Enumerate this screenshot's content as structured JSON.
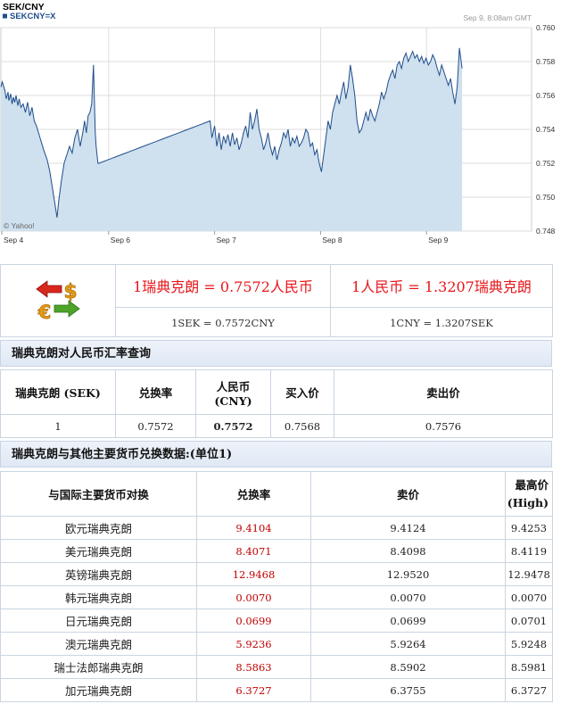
{
  "chart_data": {
    "type": "area",
    "title": "SEK/CNY",
    "legend": "SEKCNY=X",
    "timestamp": "Sep 9, 8:08am GMT",
    "watermark": "© Yahoo!",
    "x_labels": [
      "Sep 4",
      "Sep 6",
      "Sep 7",
      "Sep 8",
      "Sep 9"
    ],
    "y_ticks": [
      "0.760",
      "0.758",
      "0.756",
      "0.754",
      "0.752",
      "0.750",
      "0.748"
    ],
    "ylim": [
      0.748,
      0.76
    ],
    "grid": true,
    "colors": {
      "line": "#1f4e8c",
      "fill": "#cfe0ee",
      "grid": "#dddddd"
    },
    "x": [
      0,
      1.5,
      4.5,
      6,
      8,
      9,
      11,
      12.5,
      14,
      15.5,
      17,
      19,
      20.5,
      22.5,
      25,
      27.5,
      30,
      32.5,
      35,
      37.5,
      40,
      44,
      48,
      52,
      55,
      58,
      61,
      63,
      65,
      68,
      71,
      74,
      77,
      80,
      83,
      86,
      89,
      92,
      94,
      96,
      98,
      100,
      102,
      104,
      105,
      106,
      107,
      108,
      109,
      110,
      115,
      120,
      125,
      130,
      135,
      140,
      145,
      150,
      155,
      160,
      165,
      170,
      175,
      180,
      185,
      190,
      195,
      200,
      205,
      210,
      215,
      220,
      225,
      230,
      235,
      237,
      240,
      242.5,
      245,
      247.5,
      250,
      252.5,
      255,
      257.5,
      260,
      262.5,
      265,
      267.5,
      270,
      272.5,
      275,
      277.5,
      280,
      282.5,
      285,
      287.5,
      290,
      292.5,
      295,
      297.5,
      300,
      302.5,
      305,
      307.5,
      310,
      312.5,
      315,
      317.5,
      320,
      322.5,
      325,
      327.5,
      330,
      332.5,
      335,
      337.5,
      340,
      342.5,
      345,
      347.5,
      350,
      352.5,
      355,
      357.5,
      360,
      362.5,
      365,
      367.5,
      370,
      372.5,
      375,
      377.5,
      380,
      382.5,
      385,
      387.5,
      390,
      392.5,
      395,
      397.5,
      400,
      402.5,
      405,
      407.5,
      410,
      412.5,
      415,
      417.5,
      420,
      422.5,
      425,
      427.5,
      430,
      432.5,
      435,
      437.5,
      440,
      442.5,
      445,
      447.5,
      450,
      452.5,
      455,
      457.5,
      460,
      462.5,
      465,
      467.5,
      470,
      472.5,
      475,
      477.5,
      480,
      482.5,
      485,
      487.5,
      490,
      492.5,
      495,
      497.5,
      500,
      502.5,
      505,
      507.5,
      510,
      512.5,
      515,
      518
    ],
    "y": [
      0.7565,
      0.7568,
      0.7563,
      0.7558,
      0.7562,
      0.7557,
      0.7561,
      0.7555,
      0.7559,
      0.7556,
      0.756,
      0.7554,
      0.7558,
      0.7553,
      0.7555,
      0.755,
      0.7556,
      0.7548,
      0.7553,
      0.7545,
      0.7542,
      0.7535,
      0.7528,
      0.7522,
      0.7515,
      0.7505,
      0.7495,
      0.7488,
      0.7498,
      0.751,
      0.752,
      0.7525,
      0.753,
      0.7526,
      0.7535,
      0.754,
      0.753,
      0.7538,
      0.7545,
      0.7538,
      0.7548,
      0.755,
      0.7555,
      0.7578,
      0.7558,
      0.7538,
      0.753,
      0.7525,
      0.752,
      0.752,
      0.7521,
      0.7522,
      0.7523,
      0.7524,
      0.7525,
      0.7526,
      0.7527,
      0.7528,
      0.7529,
      0.753,
      0.7531,
      0.7532,
      0.7533,
      0.7534,
      0.7535,
      0.7536,
      0.7537,
      0.7538,
      0.7539,
      0.754,
      0.7541,
      0.7542,
      0.7543,
      0.7544,
      0.7545,
      0.7535,
      0.7542,
      0.753,
      0.7538,
      0.7528,
      0.7536,
      0.7532,
      0.7537,
      0.753,
      0.7538,
      0.7531,
      0.7535,
      0.7528,
      0.7532,
      0.7538,
      0.7542,
      0.7535,
      0.755,
      0.754,
      0.7545,
      0.7552,
      0.754,
      0.7535,
      0.7528,
      0.7532,
      0.7538,
      0.753,
      0.7525,
      0.753,
      0.7522,
      0.7528,
      0.7532,
      0.7538,
      0.7535,
      0.754,
      0.753,
      0.7535,
      0.7532,
      0.7536,
      0.753,
      0.7532,
      0.7535,
      0.754,
      0.7538,
      0.753,
      0.7532,
      0.7525,
      0.7528,
      0.752,
      0.7515,
      0.7525,
      0.7535,
      0.7545,
      0.754,
      0.755,
      0.7555,
      0.756,
      0.7555,
      0.7562,
      0.7568,
      0.7558,
      0.7565,
      0.7578,
      0.757,
      0.756,
      0.7545,
      0.7538,
      0.754,
      0.7545,
      0.755,
      0.7545,
      0.7552,
      0.7548,
      0.7545,
      0.755,
      0.7555,
      0.7562,
      0.7558,
      0.7562,
      0.7568,
      0.7572,
      0.7575,
      0.757,
      0.7578,
      0.758,
      0.7576,
      0.7582,
      0.7585,
      0.758,
      0.7583,
      0.7586,
      0.7582,
      0.7584,
      0.758,
      0.7583,
      0.7579,
      0.7582,
      0.7578,
      0.758,
      0.7584,
      0.7581,
      0.7576,
      0.7572,
      0.7578,
      0.7574,
      0.757,
      0.7566,
      0.757,
      0.7562,
      0.7555,
      0.7565,
      0.7588,
      0.7576
    ]
  },
  "rate_box": {
    "left_main": "1瑞典克朗 = 0.7572人民币",
    "right_main": "1人民币 = 1.3207瑞典克朗",
    "left_code": "1SEK = 0.7572CNY",
    "right_code": "1CNY = 1.3207SEK",
    "icon": "currency-exchange-icon"
  },
  "query": {
    "title": "瑞典克朗对人民币汇率查询",
    "headers": {
      "sek": "瑞典克朗 (SEK)",
      "rate": "兑换率",
      "cny_1": "人民币",
      "cny_2": "(CNY)",
      "buy": "买入价",
      "sell": "卖出价"
    },
    "row": {
      "sek": "1",
      "rate": "0.7572",
      "cny": "0.7572",
      "buy": "0.7568",
      "sell": "0.7576"
    }
  },
  "others": {
    "title": "瑞典克朗与其他主要货币兑换数据:(单位1)",
    "headers": {
      "name": "与国际主要货币对换",
      "rate": "兑换率",
      "sell": "卖价",
      "high_1": "最高价",
      "high_2": "(High)"
    },
    "rows": [
      {
        "name": "欧元瑞典克朗",
        "rate": "9.4104",
        "sell": "9.4124",
        "high": "9.4253"
      },
      {
        "name": "美元瑞典克朗",
        "rate": "8.4071",
        "sell": "8.4098",
        "high": "8.4119"
      },
      {
        "name": "英镑瑞典克朗",
        "rate": "12.9468",
        "sell": "12.9520",
        "high": "12.9478"
      },
      {
        "name": "韩元瑞典克朗",
        "rate": "0.0070",
        "sell": "0.0070",
        "high": "0.0070"
      },
      {
        "name": "日元瑞典克朗",
        "rate": "0.0699",
        "sell": "0.0699",
        "high": "0.0701"
      },
      {
        "name": "澳元瑞典克朗",
        "rate": "5.9236",
        "sell": "5.9264",
        "high": "5.9248"
      },
      {
        "name": "瑞士法郎瑞典克朗",
        "rate": "8.5863",
        "sell": "8.5902",
        "high": "8.5981"
      },
      {
        "name": "加元瑞典克朗",
        "rate": "6.3727",
        "sell": "6.3755",
        "high": "6.3727"
      }
    ]
  }
}
